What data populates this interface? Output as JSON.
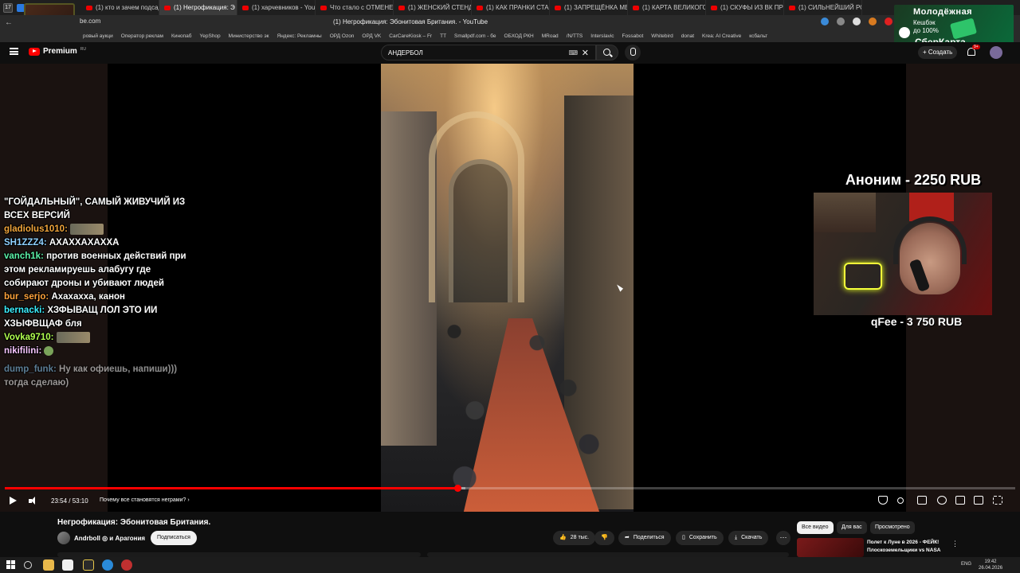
{
  "browser": {
    "tabs": [
      {
        "label": "(1) кто и зачем подсади",
        "active": false
      },
      {
        "label": "(1) Негрофикация: Э",
        "active": true
      },
      {
        "label": "(1) харчевников - YouTu",
        "active": false
      },
      {
        "label": "Что стало с ОТМЕНЕ",
        "active": false
      },
      {
        "label": "(1) ЖЕНСКИЙ СТЕНДАП",
        "active": false
      },
      {
        "label": "(1) КАК ПРАНКИ СТАЛИ",
        "active": false
      },
      {
        "label": "(1) ЗАПРЕЩЁНКА МЕСС",
        "active": false
      },
      {
        "label": "(1) КАРТА ВЕЛИКОГО П",
        "active": false
      },
      {
        "label": "(1) СКУФЫ ИЗ ВК ПРОБ",
        "active": false
      },
      {
        "label": "(1) СИЛЬНЕЙШИЙ РОЛ",
        "active": false
      }
    ],
    "tab_count": "17",
    "url_fragment": "be.com",
    "page_title": "(1) Негрофикация: Эбонитовая Британия. - YouTube",
    "bookmarks": [
      "ровый аукци",
      "Оператор реклам",
      "Кинопаб",
      "YepShop",
      "Министерство эк",
      "Яндекс: Рекламны",
      "ОРД Ozon",
      "ОРД VK",
      "CarCareKiosk – Fr",
      "TT",
      "Smallpdf.com - бе",
      "ОБХОД РКН",
      "MRoad",
      "/N/TTS",
      "Interslavic",
      "Fossabot",
      "Whitebird",
      "donat",
      "Krea: AI Creative",
      "ксбальт"
    ]
  },
  "ad_banner": {
    "line1": "Молодёжная",
    "line2": "Кешбэк",
    "line3": "до 100%",
    "line4": "СберКарта"
  },
  "youtube": {
    "logo_text": "Premium",
    "logo_region": "RU",
    "search_value": "АНДЕРБОЛ",
    "create_label": "Создать",
    "notif_count": "9+"
  },
  "stream": {
    "chat": [
      {
        "user": "",
        "text": "\"ГОЙДАЛЬНЫЙ\", САМЫЙ ЖИВУЧИЙ ИЗ ВСЕХ ВЕРСИЙ",
        "cls": "u7",
        "emote": ""
      },
      {
        "user": "gladiolus1010",
        "text": "",
        "cls": "u1",
        "emote": "wide"
      },
      {
        "user": "SH1ZZZ4",
        "text": "АХАХХАХАХХА",
        "cls": "u2",
        "emote": ""
      },
      {
        "user": "vanch1k",
        "text": "против военных действий при этом рекламируешь алабугу где собирают дроны и убивают людей",
        "cls": "u3",
        "emote": ""
      },
      {
        "user": "bur_serjo",
        "text": "Ахахахха, канон",
        "cls": "u4",
        "emote": ""
      },
      {
        "user": "bernacki",
        "text": "ХЗФЫВАЩ ЛОЛ ЭТО ИИ ХЗЫФВЩАФ бля",
        "cls": "u5",
        "emote": ""
      },
      {
        "user": "Vovka9710",
        "text": "",
        "cls": "u6",
        "emote": "wide"
      },
      {
        "user": "nikifilini",
        "text": "",
        "cls": "u7",
        "emote": "small"
      },
      {
        "user": "dump_funk",
        "text": "Ну как офиешь, напиши))) тогда сделаю)",
        "cls": "u2 old",
        "emote": ""
      }
    ],
    "donation_top": "Аноним - 2250 RUB",
    "donation_bottom": "qFee - 3 750 RUB"
  },
  "player": {
    "progress_fraction": 0.448,
    "buffered_fraction": 0.456,
    "time_current": "23:54",
    "time_total": "53:10",
    "time_display": "23:54 / 53:10",
    "chapter": "Почему все становятся неграми? ›"
  },
  "video": {
    "title": "Негрофикация: Эбонитовая Британия.",
    "channel": "Andrboll ◎ и Арагония",
    "subscribe_label": "Подписаться",
    "likes": "28 тыс.",
    "share_label": "Поделиться",
    "save_label": "Сохранить",
    "download_label": "Скачать"
  },
  "recommendations": {
    "chips": [
      "Все видео",
      "Для вас",
      "Просмотрено"
    ],
    "first_title": "Полет к Луне в 2026 - ФЕЙК! Плоскоземельщики vs NASA"
  },
  "taskbar": {
    "lang": "ENG",
    "time": "19:42",
    "date": "26.04.2026"
  }
}
